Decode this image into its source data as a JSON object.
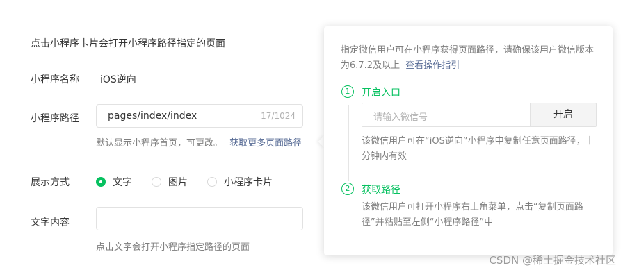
{
  "form": {
    "hint": "点击小程序卡片会打开小程序路径指定的页面",
    "name_label": "小程序名称",
    "name_value": "iOS逆向",
    "path_label": "小程序路径",
    "path_value": "pages/index/index",
    "path_counter": "17/1024",
    "path_desc": "默认显示小程序首页，可更改。",
    "path_link": "获取更多页面路径",
    "display_label": "展示方式",
    "display_options": [
      "文字",
      "图片",
      "小程序卡片"
    ],
    "display_selected": "文字",
    "text_label": "文字内容",
    "text_value": "",
    "text_desc": "点击文字会打开小程序指定路径的页面"
  },
  "popover": {
    "intro": "指定微信用户可在小程序获得页面路径，请确保该用户微信版本为6.7.2及以上",
    "intro_link": "查看操作指引",
    "step1": {
      "num": "1",
      "title": "开启入口",
      "placeholder": "请输入微信号",
      "button": "开启",
      "desc": "该微信用户可在“iOS逆向”小程序中复制任意页面路径，十分钟内有效"
    },
    "step2": {
      "num": "2",
      "title": "获取路径",
      "desc": "该微信用户可打开小程序右上角菜单，点击“复制页面路径”并粘贴至左侧“小程序路径”中"
    }
  },
  "watermark": "CSDN @稀土掘金技术社区",
  "colors": {
    "accent": "#07c160",
    "link": "#576b95"
  }
}
